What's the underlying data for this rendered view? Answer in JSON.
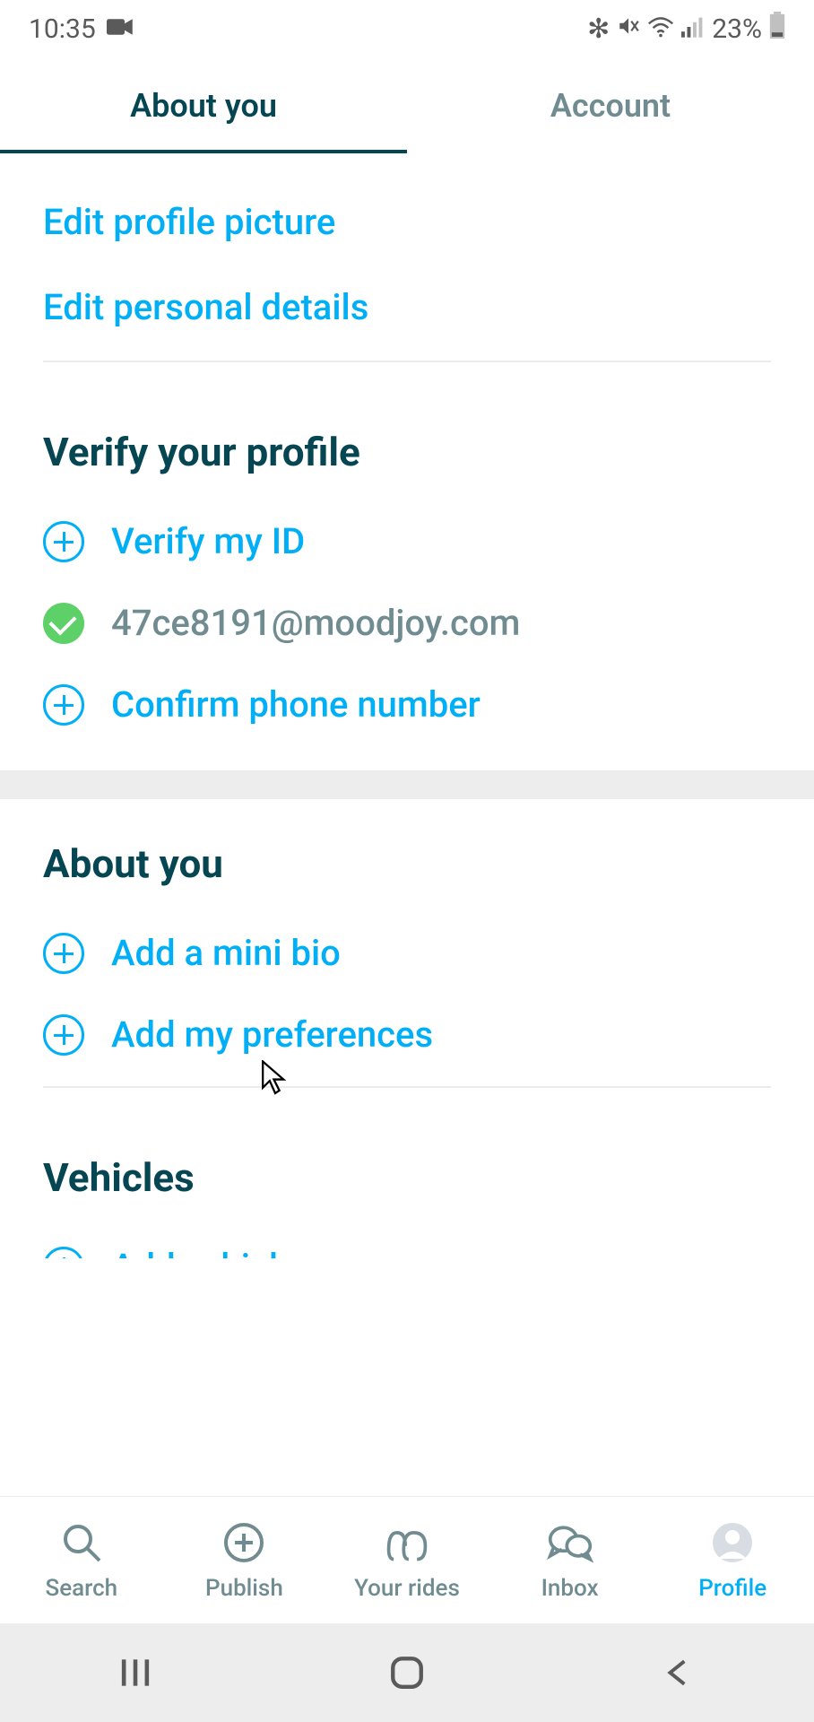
{
  "status_bar": {
    "time": "10:35",
    "battery": "23%"
  },
  "tabs": {
    "about_you": "About you",
    "account": "Account"
  },
  "edit_links": {
    "profile_picture": "Edit profile picture",
    "personal_details": "Edit personal details"
  },
  "verify_section": {
    "title": "Verify your profile",
    "verify_id": "Verify my ID",
    "email": "47ce8191@moodjoy.com",
    "confirm_phone": "Confirm phone number"
  },
  "about_section": {
    "title": "About you",
    "add_bio": "Add a mini bio",
    "add_prefs": "Add my preferences"
  },
  "vehicles_section": {
    "title": "Vehicles",
    "add_vehicle": "Add vehicle"
  },
  "bottom_nav": {
    "search": "Search",
    "publish": "Publish",
    "your_rides": "Your rides",
    "inbox": "Inbox",
    "profile": "Profile"
  }
}
